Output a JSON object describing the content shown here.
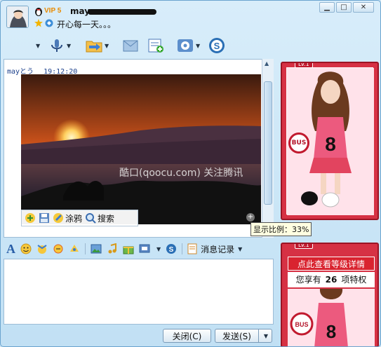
{
  "header": {
    "vip_label": "VIP 5",
    "nickname": "may",
    "signature": "开心每一天。。。"
  },
  "window_controls": {
    "minimize": "▁",
    "maximize": "□",
    "close": "✕"
  },
  "toolbar": {
    "items": [
      "voice-icon",
      "file-transfer-icon",
      "email-icon",
      "add-app-icon",
      "settings-icon",
      "soso-icon"
    ]
  },
  "chat": {
    "sender": "mayとう",
    "time": "19:12:20",
    "watermark": "酷口(qoocu.com) 关注腾讯",
    "photo_tools": {
      "doodle": "涂鸦",
      "search": "搜索"
    },
    "zoom_plus": "+",
    "zoom_tooltip": "显示比例：33%"
  },
  "format_bar": {
    "font_glyph": "A",
    "history": "消息记录"
  },
  "buttons": {
    "close": "关闭(C)",
    "send": "发送(S)"
  },
  "show_panel": {
    "level_tag": "LV.1",
    "bus_label": "BUS",
    "level_detail": "点此查看等级详情",
    "privilege_prefix": "您享有",
    "privilege_count": "26",
    "privilege_suffix": "项特权"
  },
  "colors": {
    "accent": "#2a6fb5",
    "show_red": "#d63144",
    "sky_top": "#f2a030",
    "sky_bottom": "#8a2810"
  }
}
